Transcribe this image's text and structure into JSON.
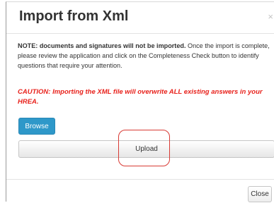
{
  "dialog": {
    "title": "Import from Xml",
    "close_glyph": "×",
    "note_bold": "NOTE: documents and signatures will not be imported.",
    "note_rest": " Once the import is complete, please review the application and click on the Completeness Check button to identify questions that require your attention.",
    "caution": "CAUTION: Importing the XML file will overwrite ALL existing answers in your HREA.",
    "browse_label": "Browse",
    "upload_label": "Upload",
    "close_label": "Close"
  },
  "colors": {
    "browse_button": "#2e98c9",
    "caution_text": "#e8211b",
    "highlight_circle": "#d83a34"
  },
  "icons": {
    "dialog_close": "close-icon"
  }
}
